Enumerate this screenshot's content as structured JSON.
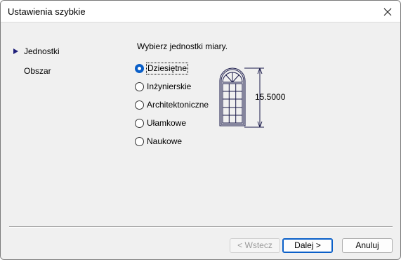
{
  "window": {
    "title": "Ustawienia szybkie"
  },
  "nav": {
    "items": [
      {
        "label": "Jednostki",
        "active": true
      },
      {
        "label": "Obszar",
        "active": false
      }
    ]
  },
  "main": {
    "prompt": "Wybierz jednostki miary.",
    "options": [
      {
        "label": "Dziesiętne",
        "selected": true
      },
      {
        "label": "Inżynierskie",
        "selected": false
      },
      {
        "label": "Architektoniczne",
        "selected": false
      },
      {
        "label": "Ułamkowe",
        "selected": false
      },
      {
        "label": "Naukowe",
        "selected": false
      }
    ],
    "preview_value": "15.5000"
  },
  "buttons": {
    "back": "< Wstecz",
    "next": "Dalej >",
    "cancel": "Anuluj"
  },
  "colors": {
    "accent": "#0a5fc8",
    "nav_arrow": "#1f1f7a",
    "preview_stroke": "#1a1a4a"
  },
  "icons": {
    "close": "close-icon",
    "nav_active": "triangle-right-icon",
    "preview": "window-drawing-icon"
  }
}
